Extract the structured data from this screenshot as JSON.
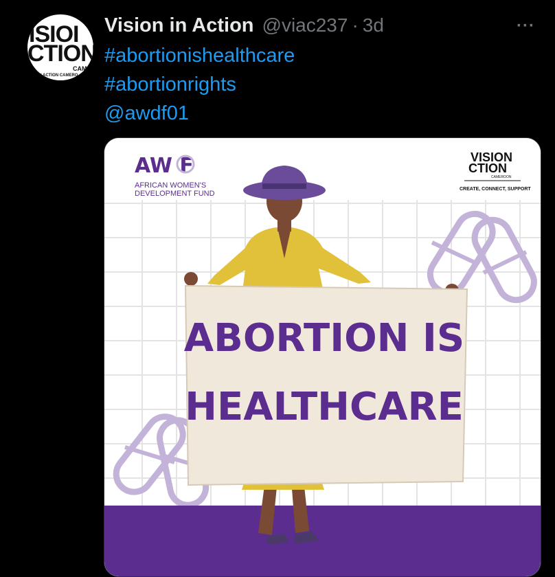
{
  "avatar": {
    "line1": "ISIOI",
    "line2": "CTION",
    "line3": "CAMERO",
    "line4": "ON IN ACTION CAMERO"
  },
  "tweet": {
    "author_name": "Vision in Action",
    "handle": "@viac237",
    "separator": "·",
    "time": "3d",
    "more_label": "···",
    "lines": [
      "#abortionishealthcare",
      "#abortionrights",
      "@awdf01"
    ]
  },
  "image": {
    "awdf_logo": "AW F",
    "awdf_name_line1": "AFRICAN WOMEN'S",
    "awdf_name_line2": "DEVELOPMENT FUND",
    "via_logo_line1": "VISION",
    "via_logo_line2": "CTION",
    "via_logo_line3": "CAMEROON",
    "via_tagline": "CREATE, CONNECT, SUPPORT",
    "sign_line1": "ABORTION IS",
    "sign_line2": "HEALTHCARE",
    "colors": {
      "purple": "#5b2d8e",
      "lilac": "#b9a3d3",
      "sign": "#f1e8dc",
      "coat": "#e2c13a",
      "hat": "#6b4c9a",
      "skin": "#7a4a34"
    }
  }
}
